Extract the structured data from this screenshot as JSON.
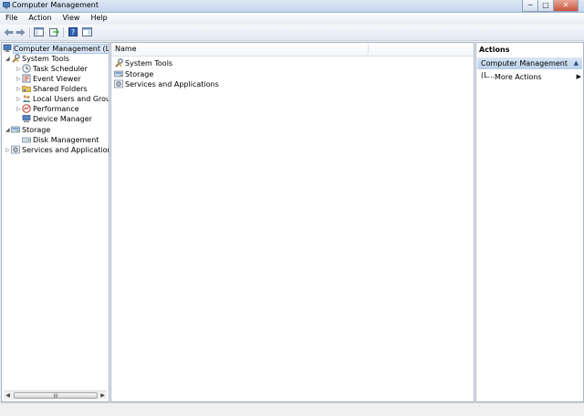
{
  "window": {
    "title": "Computer Management",
    "controls": {
      "minimize": "─",
      "maximize": "□",
      "close": "✕"
    }
  },
  "menu": [
    "File",
    "Action",
    "View",
    "Help"
  ],
  "toolbar": {
    "icons": [
      "back-arrow-icon",
      "forward-arrow-icon",
      "show-hide-console-tree-icon",
      "export-list-icon",
      "help-icon",
      "show-hide-action-pane-icon"
    ]
  },
  "tree": {
    "items": [
      {
        "label": "Computer Management (Local",
        "icon": "computer-management-icon",
        "expander": "",
        "selected": true
      },
      {
        "label": "System Tools",
        "icon": "system-tools-icon",
        "expander": "◢"
      },
      {
        "label": "Task Scheduler",
        "icon": "clock-icon",
        "expander": "▷"
      },
      {
        "label": "Event Viewer",
        "icon": "event-viewer-icon",
        "expander": "▷"
      },
      {
        "label": "Shared Folders",
        "icon": "shared-folder-icon",
        "expander": "▷"
      },
      {
        "label": "Local Users and Groups",
        "icon": "users-icon",
        "expander": "▷"
      },
      {
        "label": "Performance",
        "icon": "performance-icon",
        "expander": "▷"
      },
      {
        "label": "Device Manager",
        "icon": "device-manager-icon",
        "expander": ""
      },
      {
        "label": "Storage",
        "icon": "storage-icon",
        "expander": "◢"
      },
      {
        "label": "Disk Management",
        "icon": "disk-icon",
        "expander": ""
      },
      {
        "label": "Services and Applications",
        "icon": "services-icon",
        "expander": "▷"
      }
    ],
    "scroll": {
      "left": "◀",
      "right": "▶",
      "grip": "III"
    }
  },
  "list": {
    "column": "Name",
    "rows": [
      {
        "label": "System Tools",
        "icon": "system-tools-icon"
      },
      {
        "label": "Storage",
        "icon": "storage-icon"
      },
      {
        "label": "Services and Applications",
        "icon": "services-icon"
      }
    ]
  },
  "actions": {
    "title": "Actions",
    "header": "Computer Management (L...",
    "collapse": "▲",
    "more": "More Actions",
    "more_arrow": "▶"
  }
}
